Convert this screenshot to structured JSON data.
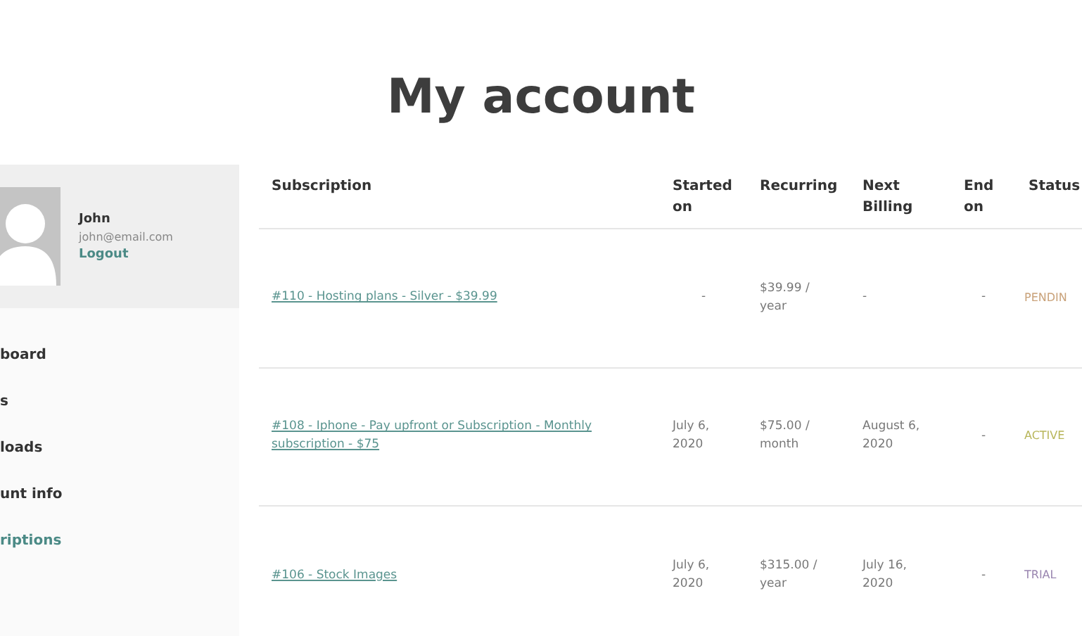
{
  "title": "My account",
  "profile": {
    "name": "John",
    "email": "john@email.com",
    "logout": "Logout"
  },
  "nav": [
    {
      "label": "board",
      "selected": false
    },
    {
      "label": "s",
      "selected": false
    },
    {
      "label": "loads",
      "selected": false
    },
    {
      "label": "unt info",
      "selected": false
    },
    {
      "label": "riptions",
      "selected": true
    }
  ],
  "table": {
    "columns": [
      "Subscription",
      "Started on",
      "Recurring",
      "Next Billing",
      "End on",
      "Status"
    ],
    "rows": [
      {
        "subscription": "#110 - Hosting plans - Silver - $39.99",
        "started": "-",
        "recurring": "$39.99 / year",
        "next": "-",
        "end": "-",
        "status": "PENDIN",
        "color": "#c9a27a"
      },
      {
        "subscription": "#108 - Iphone - Pay upfront or Subscription - Monthly subscription - $75",
        "started": "July 6, 2020",
        "recurring": "$75.00 / month",
        "next": "August 6, 2020",
        "end": "-",
        "status": "ACTIVE",
        "color": "#b8b65a"
      },
      {
        "subscription": "#106 - Stock Images",
        "started": "July 6, 2020",
        "recurring": "$315.00 / year",
        "next": "July 16, 2020",
        "end": "-",
        "status": "TRIAL",
        "color": "#9a86b0"
      }
    ]
  }
}
